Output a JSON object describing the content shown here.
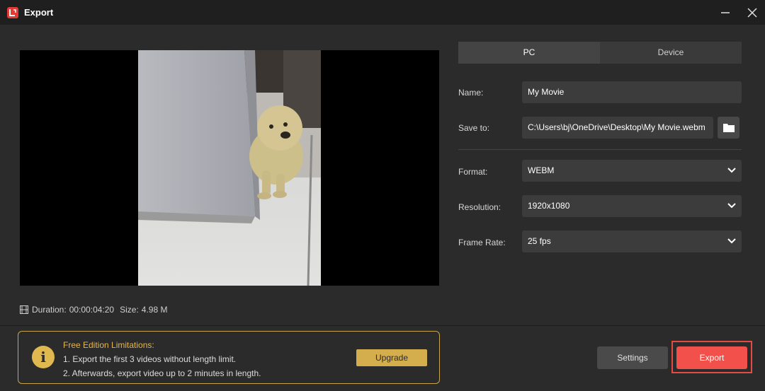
{
  "window": {
    "title": "Export",
    "logo_icon": "app-logo-icon"
  },
  "tabs": [
    {
      "label": "PC",
      "active": true
    },
    {
      "label": "Device",
      "active": false
    }
  ],
  "form": {
    "name_label": "Name:",
    "name_value": "My Movie",
    "save_label": "Save to:",
    "save_value": "C:\\Users\\bj\\OneDrive\\Desktop\\My Movie.webm",
    "format_label": "Format:",
    "format_value": "WEBM",
    "resolution_label": "Resolution:",
    "resolution_value": "1920x1080",
    "framerate_label": "Frame Rate:",
    "framerate_value": "25 fps"
  },
  "info": {
    "duration_label": "Duration:",
    "duration_value": "00:00:04:20",
    "size_label": "Size:",
    "size_value": "4.98 M"
  },
  "notice": {
    "heading": "Free Edition Limitations:",
    "line1": "1. Export the first 3 videos without length limit.",
    "line2": "2. Afterwards, export video up to 2 minutes in length.",
    "upgrade_label": "Upgrade",
    "icon_glyph": "i"
  },
  "buttons": {
    "settings_label": "Settings",
    "export_label": "Export"
  },
  "colors": {
    "accent": "#f2504a",
    "notice_gold": "#e0b850",
    "background": "#2b2b2b"
  }
}
